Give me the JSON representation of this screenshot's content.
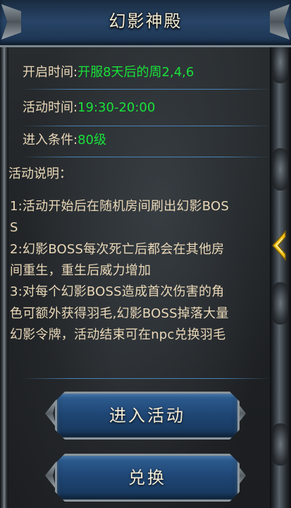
{
  "header": {
    "title": "幻影神殿"
  },
  "info": {
    "open_time": {
      "label": "开启时间:",
      "value": "开服8天后的周2,4,6"
    },
    "activity_time": {
      "label": "活动时间:",
      "value": "19:30-20:00"
    },
    "requirement": {
      "label": "进入条件:",
      "value": "80级"
    }
  },
  "description": {
    "title": "活动说明：",
    "lines": [
      "1:活动开始后在随机房间刷出幻影BOS",
      "S",
      "2:幻影BOSS每次死亡后都会在其他房",
      "间重生，重生后威力增加",
      "3:对每个幻影BOSS造成首次伤害的角",
      "色可额外获得羽毛,幻影BOSS掉落大量",
      "幻影令牌，活动结束可在npc兑换羽毛"
    ]
  },
  "buttons": {
    "enter": "进入活动",
    "exchange": "兑换"
  },
  "side_tab": {
    "icon": "chevron-left-icon"
  },
  "colors": {
    "label": "#ead8b8",
    "value": "#19e23a",
    "button": "#1e4573"
  }
}
